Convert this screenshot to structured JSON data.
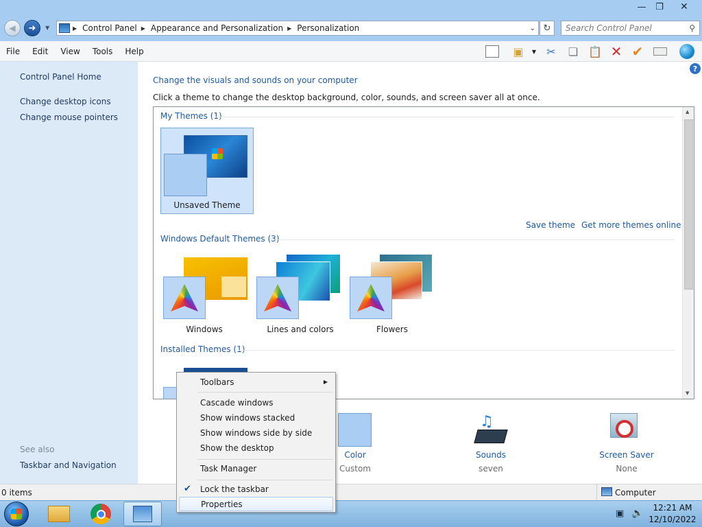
{
  "window": {
    "minimize_icon": "minimize-icon",
    "restore_icon": "restore-icon",
    "close_icon": "close-icon"
  },
  "address": {
    "crumbs": [
      "Control Panel",
      "Appearance and Personalization",
      "Personalization"
    ],
    "search_placeholder": "Search Control Panel"
  },
  "menu": [
    "File",
    "Edit",
    "View",
    "Tools",
    "Help"
  ],
  "left": {
    "home": "Control Panel Home",
    "links": [
      "Change desktop icons",
      "Change mouse pointers"
    ],
    "see_also": "See also",
    "see_also_links": [
      "Taskbar and Navigation"
    ]
  },
  "main": {
    "title": "Change the visuals and sounds on your computer",
    "subtitle": "Click a theme to change the desktop background, color, sounds, and screen saver all at once.",
    "my_themes": "My Themes (1)",
    "unsaved_theme": "Unsaved Theme",
    "save_theme": "Save theme",
    "get_more": "Get more themes online",
    "default_themes": "Windows Default Themes (3)",
    "default_items": [
      "Windows",
      "Lines and colors",
      "Flowers"
    ],
    "installed_themes": "Installed Themes (1)"
  },
  "bottom": {
    "color_label": "Color",
    "color_value": "Custom",
    "sounds_label": "Sounds",
    "sounds_value": "seven",
    "saver_label": "Screen Saver",
    "saver_value": "None"
  },
  "status": {
    "items": "0 items",
    "location": "Computer"
  },
  "context_menu": {
    "toolbars": "Toolbars",
    "cascade": "Cascade windows",
    "stacked": "Show windows stacked",
    "side": "Show windows side by side",
    "desktop": "Show the desktop",
    "task_manager": "Task Manager",
    "lock": "Lock the taskbar",
    "properties": "Properties"
  },
  "clock": {
    "time": "12:21 AM",
    "date": "12/10/2022"
  },
  "colors": {
    "accent": "#1e5aa0",
    "frame": "#a6cdf1",
    "taskbar": "#8fbfe6"
  }
}
